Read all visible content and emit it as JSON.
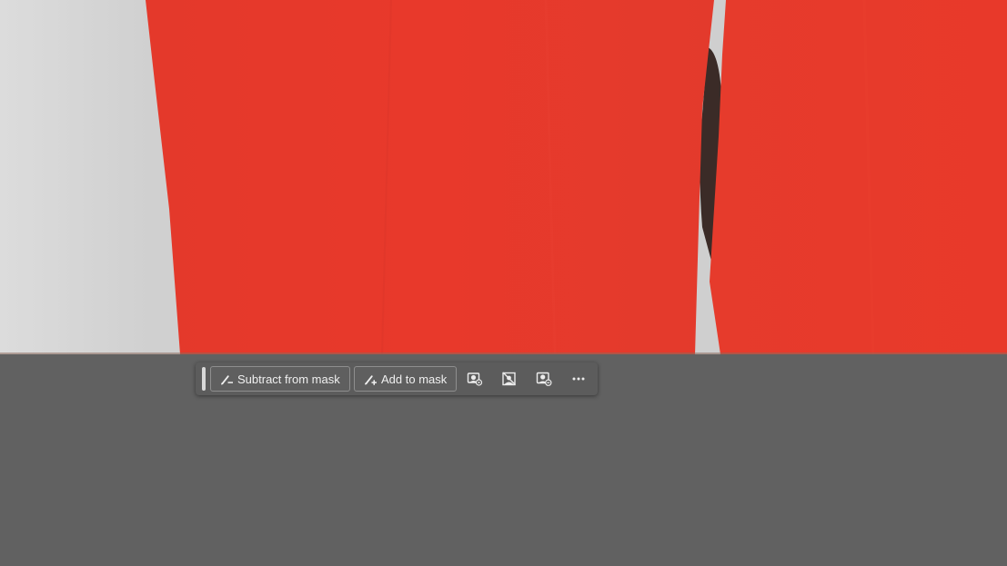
{
  "canvas": {
    "content": "photo-red-garment",
    "colors": {
      "garment": "#e63a2c",
      "background_wall": "#d2d2d2",
      "shadow": "#3a2a26"
    }
  },
  "workspace": {
    "background_color": "#616161"
  },
  "taskbar": {
    "subtract_label": "Subtract from mask",
    "subtract_icon": "brush-minus-icon",
    "add_label": "Add to mask",
    "add_icon": "brush-plus-icon",
    "icon_buttons": [
      {
        "name": "mask-settings-icon"
      },
      {
        "name": "invert-mask-icon"
      },
      {
        "name": "mask-overlay-icon"
      },
      {
        "name": "more-options-icon"
      }
    ],
    "colors": {
      "bar": "#5c5c5c",
      "button_border": "#8e8e8e",
      "text": "#f0f0f0"
    }
  }
}
